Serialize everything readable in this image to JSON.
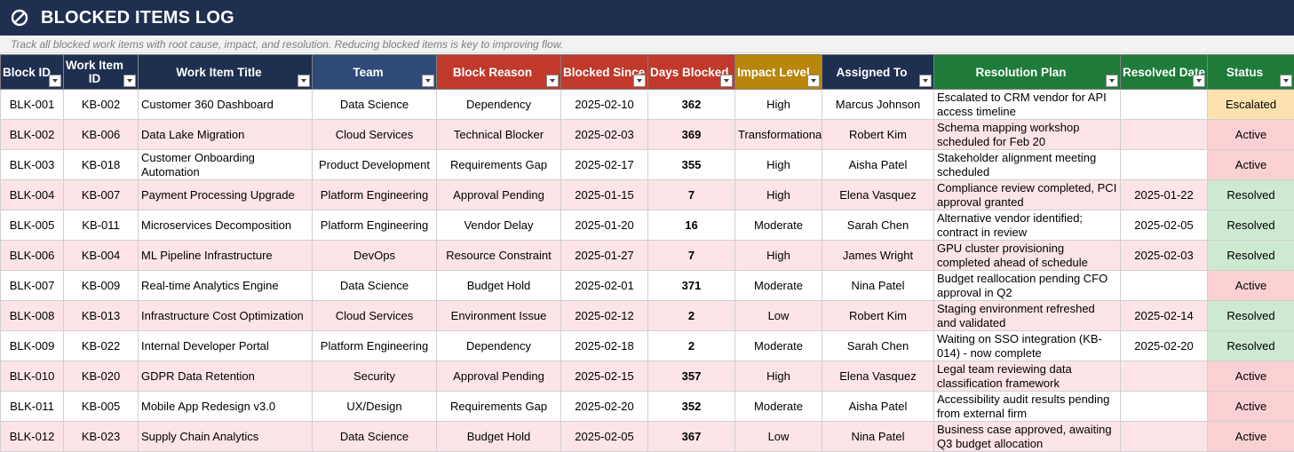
{
  "header": {
    "title": "BLOCKED ITEMS LOG",
    "icon": "prohibited-icon",
    "subtitle": "Track all blocked work items with root cause, impact, and resolution. Reducing blocked items is key to improving flow."
  },
  "colors": {
    "title_bg": "#1f2f4f",
    "header_navy": "#1f2f4f",
    "header_blue": "#2f4a78",
    "header_red": "#c0392b",
    "header_gold": "#b8860b",
    "header_green": "#1e7b3a",
    "row_alt": "#fde4e6",
    "active": "#fbd0d3",
    "resolved": "#cde9d2",
    "escalated": "#fde2b0"
  },
  "columns": [
    {
      "label": "Block ID",
      "color": "#1f2f4f"
    },
    {
      "label": "Work Item ID",
      "color": "#1f2f4f"
    },
    {
      "label": "Work Item Title",
      "color": "#1f2f4f"
    },
    {
      "label": "Team",
      "color": "#2f4a78"
    },
    {
      "label": "Block Reason",
      "color": "#c0392b"
    },
    {
      "label": "Blocked Since",
      "color": "#c0392b"
    },
    {
      "label": "Days Blocked",
      "color": "#c0392b"
    },
    {
      "label": "Impact Level",
      "color": "#b8860b"
    },
    {
      "label": "Assigned To",
      "color": "#1f2f4f"
    },
    {
      "label": "Resolution Plan",
      "color": "#1e7b3a"
    },
    {
      "label": "Resolved Date",
      "color": "#1e7b3a"
    },
    {
      "label": "Status",
      "color": "#1e7b3a"
    }
  ],
  "rows": [
    {
      "block_id": "BLK-001",
      "item_id": "KB-002",
      "title": "Customer 360 Dashboard",
      "team": "Data Science",
      "reason": "Dependency",
      "since": "2025-02-10",
      "days": "362",
      "impact": "High",
      "assigned": "Marcus Johnson",
      "plan": "Escalated to CRM vendor for API access timeline",
      "resolved": "",
      "status": "Escalated"
    },
    {
      "block_id": "BLK-002",
      "item_id": "KB-006",
      "title": "Data Lake Migration",
      "team": "Cloud Services",
      "reason": "Technical Blocker",
      "since": "2025-02-03",
      "days": "369",
      "impact": "Transformational",
      "assigned": "Robert Kim",
      "plan": "Schema mapping workshop scheduled for Feb 20",
      "resolved": "",
      "status": "Active"
    },
    {
      "block_id": "BLK-003",
      "item_id": "KB-018",
      "title": "Customer Onboarding Automation",
      "team": "Product Development",
      "reason": "Requirements Gap",
      "since": "2025-02-17",
      "days": "355",
      "impact": "High",
      "assigned": "Aisha Patel",
      "plan": "Stakeholder alignment meeting scheduled",
      "resolved": "",
      "status": "Active"
    },
    {
      "block_id": "BLK-004",
      "item_id": "KB-007",
      "title": "Payment Processing Upgrade",
      "team": "Platform Engineering",
      "reason": "Approval Pending",
      "since": "2025-01-15",
      "days": "7",
      "impact": "High",
      "assigned": "Elena Vasquez",
      "plan": "Compliance review completed, PCI approval granted",
      "resolved": "2025-01-22",
      "status": "Resolved"
    },
    {
      "block_id": "BLK-005",
      "item_id": "KB-011",
      "title": "Microservices Decomposition",
      "team": "Platform Engineering",
      "reason": "Vendor Delay",
      "since": "2025-01-20",
      "days": "16",
      "impact": "Moderate",
      "assigned": "Sarah Chen",
      "plan": "Alternative vendor identified; contract in review",
      "resolved": "2025-02-05",
      "status": "Resolved"
    },
    {
      "block_id": "BLK-006",
      "item_id": "KB-004",
      "title": "ML Pipeline Infrastructure",
      "team": "DevOps",
      "reason": "Resource Constraint",
      "since": "2025-01-27",
      "days": "7",
      "impact": "High",
      "assigned": "James Wright",
      "plan": "GPU cluster provisioning completed ahead of schedule",
      "resolved": "2025-02-03",
      "status": "Resolved"
    },
    {
      "block_id": "BLK-007",
      "item_id": "KB-009",
      "title": "Real-time Analytics Engine",
      "team": "Data Science",
      "reason": "Budget Hold",
      "since": "2025-02-01",
      "days": "371",
      "impact": "Moderate",
      "assigned": "Nina Patel",
      "plan": "Budget reallocation pending CFO approval in Q2",
      "resolved": "",
      "status": "Active"
    },
    {
      "block_id": "BLK-008",
      "item_id": "KB-013",
      "title": "Infrastructure Cost Optimization",
      "team": "Cloud Services",
      "reason": "Environment Issue",
      "since": "2025-02-12",
      "days": "2",
      "impact": "Low",
      "assigned": "Robert Kim",
      "plan": "Staging environment refreshed and validated",
      "resolved": "2025-02-14",
      "status": "Resolved"
    },
    {
      "block_id": "BLK-009",
      "item_id": "KB-022",
      "title": "Internal Developer Portal",
      "team": "Platform Engineering",
      "reason": "Dependency",
      "since": "2025-02-18",
      "days": "2",
      "impact": "Moderate",
      "assigned": "Sarah Chen",
      "plan": "Waiting on SSO integration (KB-014) - now complete",
      "resolved": "2025-02-20",
      "status": "Resolved"
    },
    {
      "block_id": "BLK-010",
      "item_id": "KB-020",
      "title": "GDPR Data Retention",
      "team": "Security",
      "reason": "Approval Pending",
      "since": "2025-02-15",
      "days": "357",
      "impact": "High",
      "assigned": "Elena Vasquez",
      "plan": "Legal team reviewing data classification framework",
      "resolved": "",
      "status": "Active"
    },
    {
      "block_id": "BLK-011",
      "item_id": "KB-005",
      "title": "Mobile App Redesign v3.0",
      "team": "UX/Design",
      "reason": "Requirements Gap",
      "since": "2025-02-20",
      "days": "352",
      "impact": "Moderate",
      "assigned": "Aisha Patel",
      "plan": "Accessibility audit results pending from external firm",
      "resolved": "",
      "status": "Active"
    },
    {
      "block_id": "BLK-012",
      "item_id": "KB-023",
      "title": "Supply Chain Analytics",
      "team": "Data Science",
      "reason": "Budget Hold",
      "since": "2025-02-05",
      "days": "367",
      "impact": "Low",
      "assigned": "Nina Patel",
      "plan": "Business case approved, awaiting Q3 budget allocation",
      "resolved": "",
      "status": "Active"
    }
  ]
}
